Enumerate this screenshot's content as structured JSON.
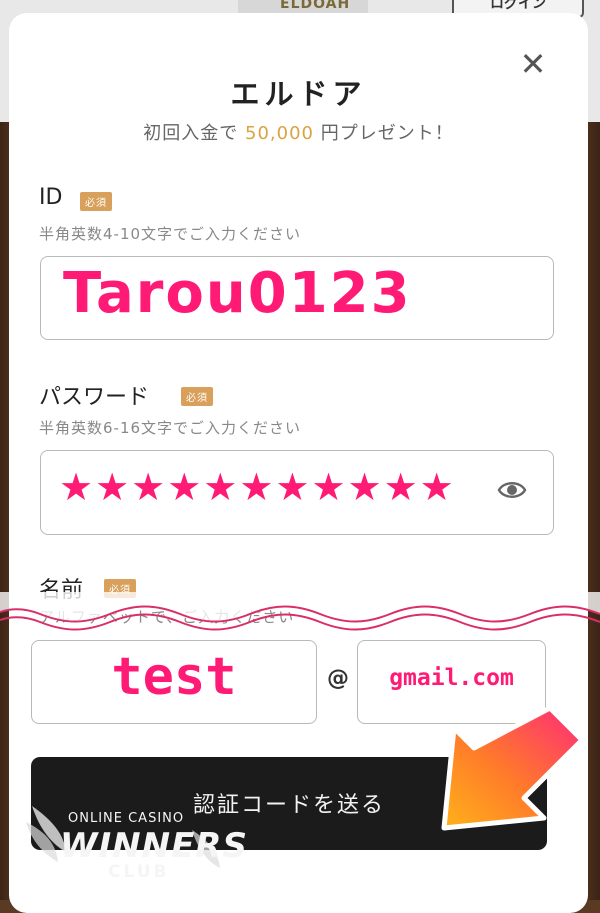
{
  "background": {
    "logo_text": "ELDOAH",
    "login_label": "ログイン"
  },
  "modal": {
    "title": "エルドア",
    "promo_prefix": "初回入金で",
    "promo_amount": "50,000",
    "promo_suffix": "円プレゼント！",
    "close_glyph": "✕"
  },
  "form": {
    "required_badge": "必須",
    "id": {
      "label": "ID",
      "hint": "半角英数4-10文字でご入力ください",
      "value": "Tarou0123"
    },
    "password": {
      "label": "パスワード",
      "hint": "半角英数6-16文字でご入力ください",
      "value": "★★★★★★★★★★★",
      "toggle_icon": "eye-icon"
    },
    "name": {
      "label": "名前",
      "hint": "アルファベットで、ご入力ください"
    },
    "email": {
      "user_value": "test",
      "at": "@",
      "domain_value": "gmail.com"
    },
    "send_button": "認証コードを送る"
  },
  "watermark": {
    "line1": "ONLINE CASINO",
    "line2": "WINNERS",
    "line3": "CLUB"
  },
  "colors": {
    "accent_pink": "#ff1a76",
    "promo_gold": "#d9a441",
    "badge": "#d9a05b",
    "button_bg": "#1b1b1b"
  }
}
